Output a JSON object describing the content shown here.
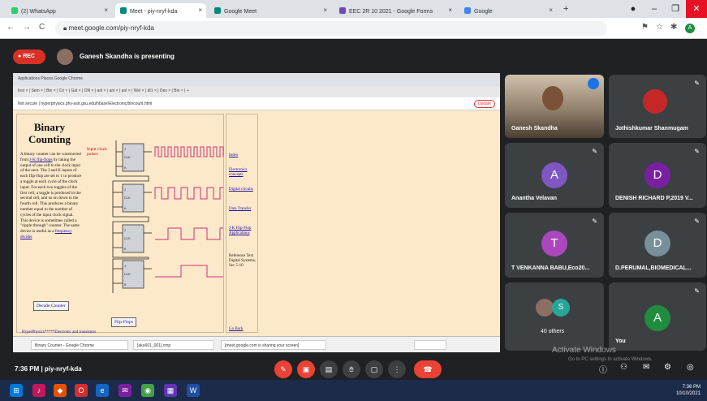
{
  "browser": {
    "tabs": [
      {
        "label": "(2) WhatsApp",
        "color": "#25d366"
      },
      {
        "label": "Meet - piy-nryf-kda",
        "color": "#00897b"
      },
      {
        "label": "Google Meet",
        "color": "#00897b"
      },
      {
        "label": "EEC 2R 10 2021 - Google Forms",
        "color": "#7248b9"
      },
      {
        "label": "Google",
        "color": "#4285f4"
      }
    ],
    "url": "meet.google.com/piy-nryf-kda"
  },
  "meet": {
    "rec_label": "REC",
    "presenting_text": "Ganesh Skandha is presenting",
    "meeting_time": "7:36 PM",
    "meeting_code": "piy-nryf-kda",
    "activate_title": "Activate Windows",
    "activate_sub": "Go to PC settings to activate Windows."
  },
  "share": {
    "tab_strip": "Applications   Places   Google Chrome",
    "tabs_row": "Inst  × | Sem  × | Bin  × | Cri  × | Gal  × | ON  × | anl  × | anl  × | anl  × | Wel  × | dt1  × | Des  × | Bin  × | +",
    "address": "Not secure | hyperphysics.phy-astr.gsu.edu/hbase/Electronic/bincount.html",
    "update_label": "Update",
    "page_title": "Binary Counting",
    "body_text_1": "A binary counter can be constructed from ",
    "body_link": "J-K flip-flops",
    "body_text_2": " by taking the output of one cell to the clock input of the next. The J and K inputs of each flip-flop are set to 1 to produce a toggle at each cycle of the clock input. For each two toggles of the first cell, a toggle is produced in the second cell, and so on down to the fourth cell. This produces a binary number equal to the number of cycles of the input clock signal. This device is sometimes called a \"ripple through\" counter. The same device is useful as a ",
    "body_link_2": "frequency divider",
    "input_clock_label": "Input clock pulses",
    "decade_counter": "Decade Counter",
    "flipflops": "Flip-Flops",
    "bottom_line": "HyperPhysics*****Electronic and transistors",
    "side_links": [
      "Index",
      "Electronics concepts",
      "Digital circuits",
      "Data Transfer",
      "J-K Flip-Flop Applications"
    ],
    "reference": "Reference Text Digital Systems, Sec 5-10",
    "go_back": "Go Back",
    "taskbar_items": [
      "Binary Counter - Google Chrome",
      "[aku601_001].cmp",
      "[meet.google.com is sharing your screen]"
    ]
  },
  "participants": [
    {
      "name": "Ganesh Skandha"
    },
    {
      "name": "Jothishkumar Shanmugam"
    },
    {
      "name": "Anantha Velavan",
      "initial": "A",
      "color": "#7e57c2"
    },
    {
      "name": "DENISH RICHARD P,2019 V...",
      "initial": "D",
      "color": "#7b1fa2"
    },
    {
      "name": "T VENKANNA BABU,Eco20...",
      "initial": "T",
      "color": "#ab47bc"
    },
    {
      "name": "D.PERUMAL,BIOMEDICAL...",
      "initial": "D",
      "color": "#78909c"
    },
    {
      "name": "40 others",
      "initial": "S",
      "color": "#26a69a"
    },
    {
      "name": "You",
      "initial": "A",
      "color": "#1e8e3e"
    }
  ],
  "taskbar": {
    "time": "7:36 PM",
    "date": "10/10/2021"
  }
}
